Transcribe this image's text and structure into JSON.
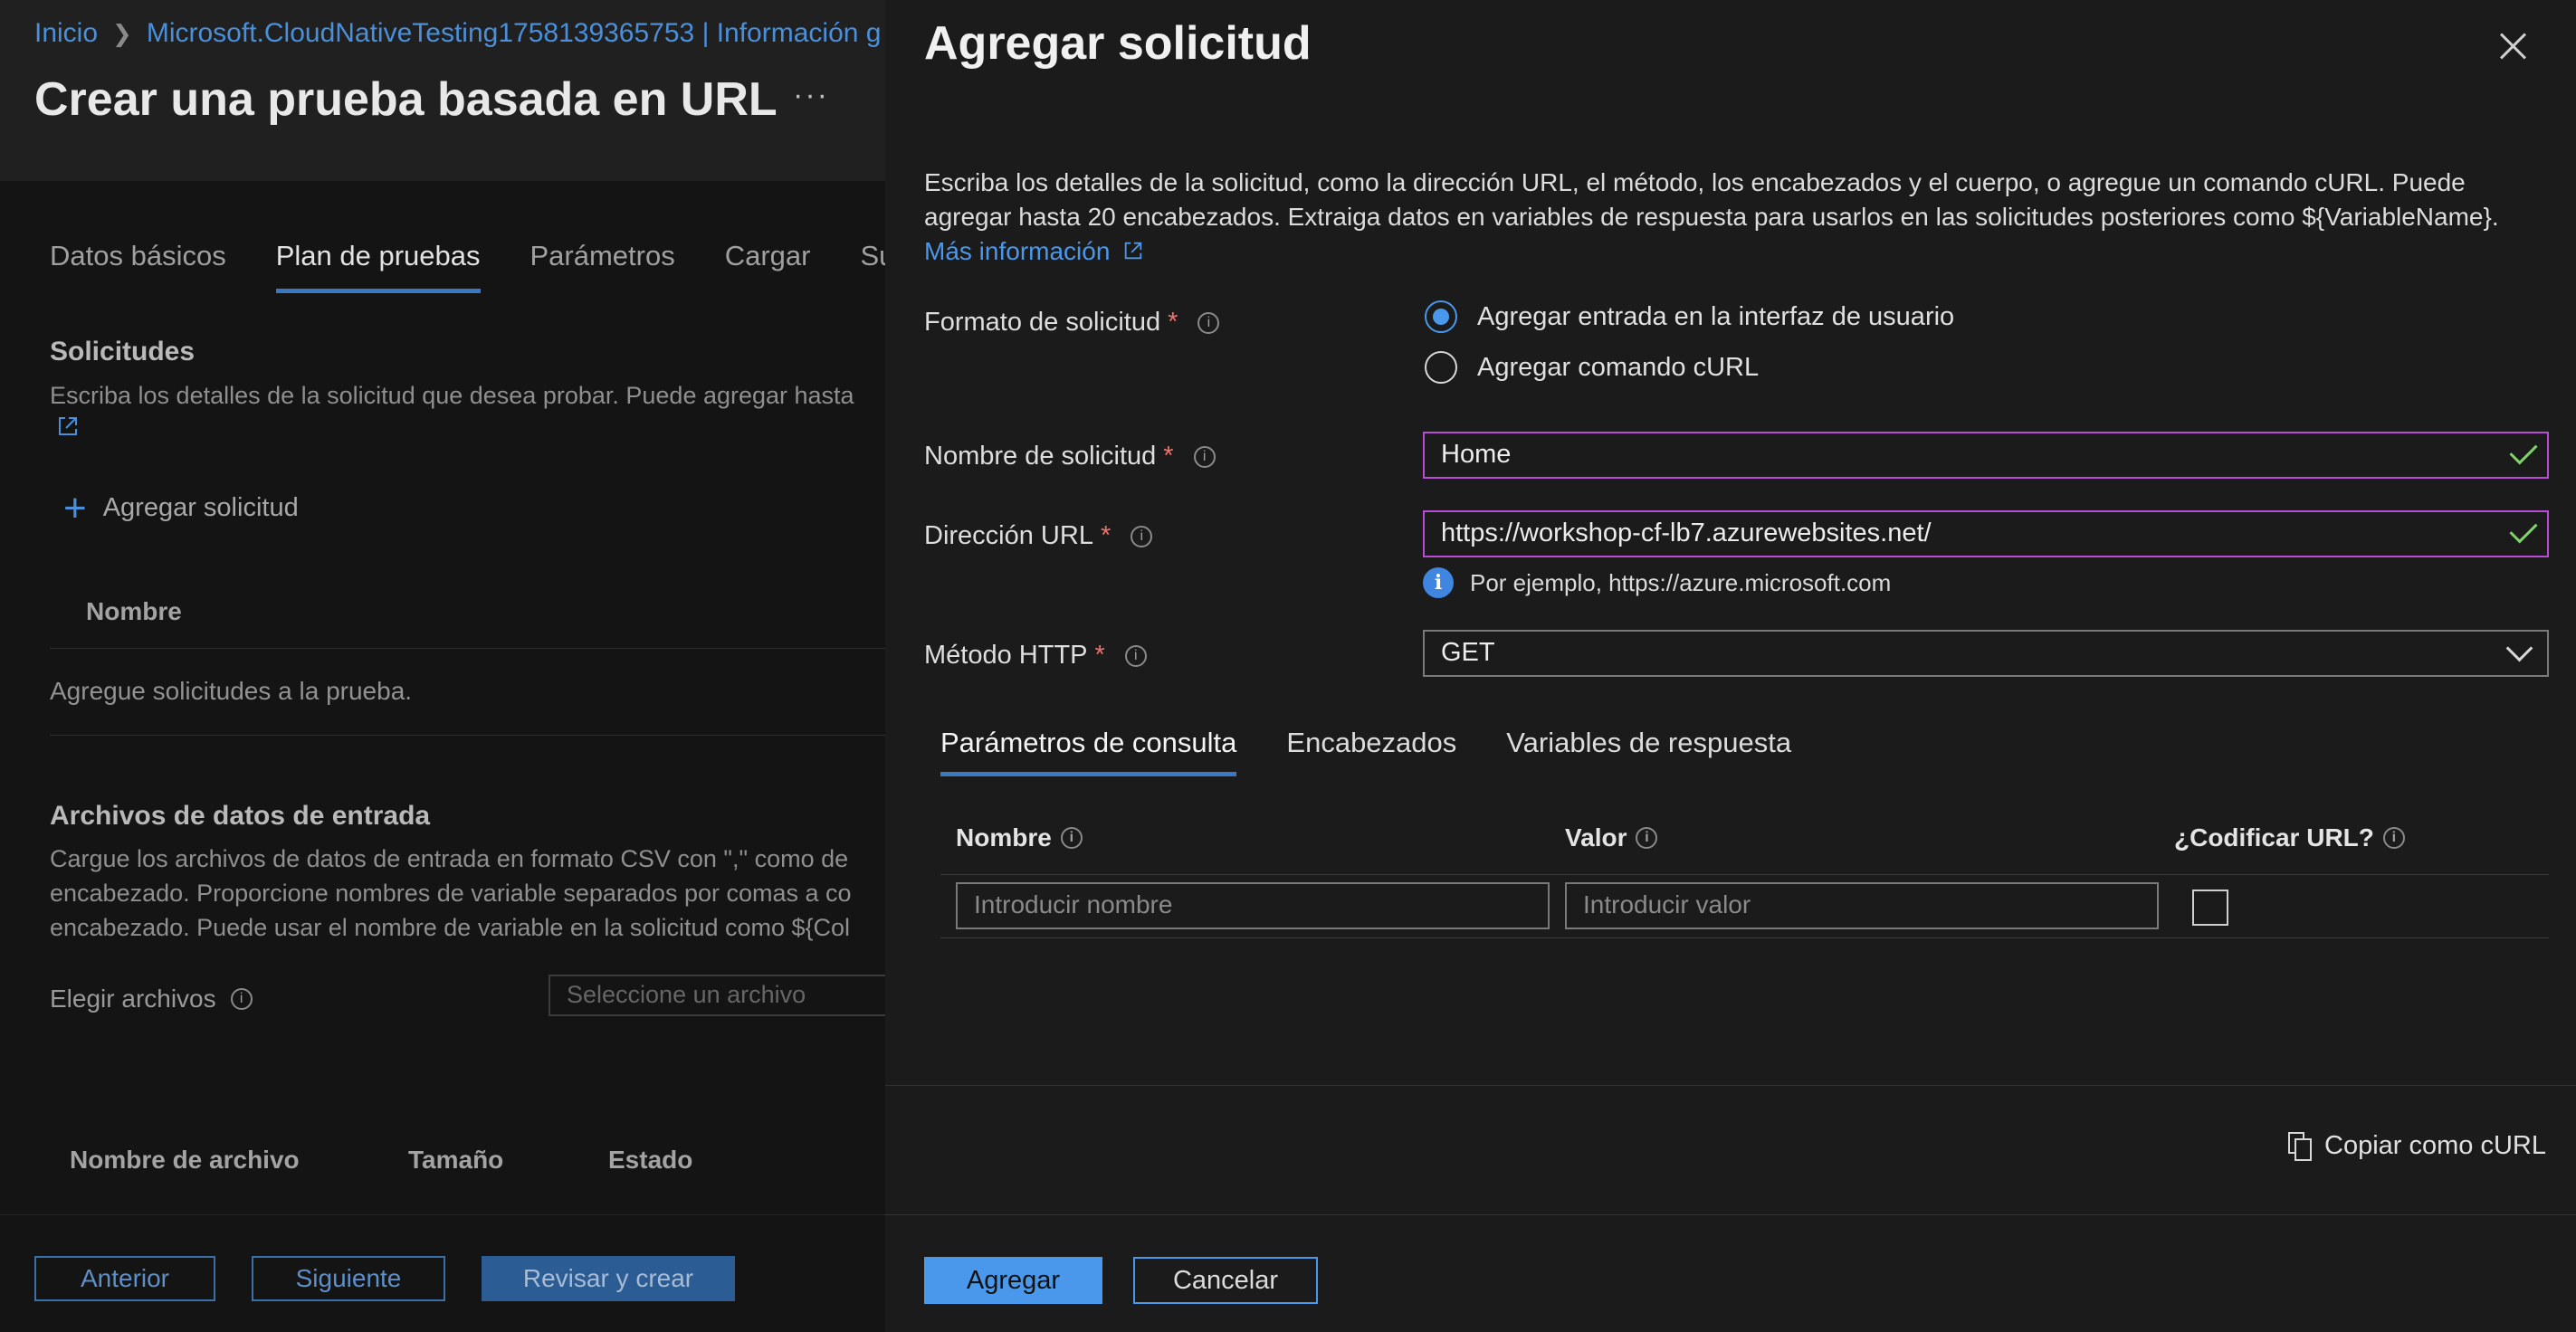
{
  "background": {
    "breadcrumb": [
      "Inicio",
      "Microsoft.CloudNativeTesting1758139365753 | Información g"
    ],
    "page_title": "Crear una prueba basada en URL",
    "more_label": "···",
    "tabs": [
      {
        "label": "Datos básicos",
        "active": false
      },
      {
        "label": "Plan de pruebas",
        "active": true
      },
      {
        "label": "Parámetros",
        "active": false
      },
      {
        "label": "Cargar",
        "active": false
      },
      {
        "label": "Sup",
        "active": false
      }
    ],
    "requests": {
      "title": "Solicitudes",
      "description": "Escriba los detalles de la solicitud que desea probar. Puede agregar hasta",
      "add_label": "Agregar solicitud",
      "column_name": "Nombre",
      "empty_message": "Agregue solicitudes a la prueba."
    },
    "input_files": {
      "title": "Archivos de datos de entrada",
      "description_lines": [
        "Cargue los archivos de datos de entrada en formato CSV con \",\" como de",
        "encabezado. Proporcione nombres de variable separados por comas a co",
        "encabezado. Puede usar el nombre de variable en la solicitud como ${Col"
      ],
      "choose_label": "Elegir archivos",
      "file_placeholder": "Seleccione un archivo",
      "columns": [
        "Nombre de archivo",
        "Tamaño",
        "Estado"
      ]
    },
    "footer": {
      "previous": "Anterior",
      "next": "Siguiente",
      "review": "Revisar y crear"
    }
  },
  "panel": {
    "title": "Agregar solicitud",
    "description": "Escriba los detalles de la solicitud, como la dirección URL, el método, los encabezados y el cuerpo, o agregue un comando cURL. Puede agregar hasta 20 encabezados. Extraiga datos en variables de respuesta para usarlos en las solicitudes posteriores como ${VariableName}.",
    "learn_more": "Más información",
    "format": {
      "label": "Formato de solicitud",
      "options": [
        {
          "label": "Agregar entrada en la interfaz de usuario",
          "selected": true
        },
        {
          "label": "Agregar comando cURL",
          "selected": false
        }
      ]
    },
    "request_name": {
      "label": "Nombre de solicitud",
      "value": "Home"
    },
    "url": {
      "label": "Dirección URL",
      "value": "https://workshop-cf-lb7.azurewebsites.net/",
      "hint": "Por ejemplo, https://azure.microsoft.com"
    },
    "method": {
      "label": "Método HTTP",
      "value": "GET"
    },
    "tabs": [
      {
        "label": "Parámetros de consulta",
        "active": true
      },
      {
        "label": "Encabezados",
        "active": false
      },
      {
        "label": "Variables de respuesta",
        "active": false
      }
    ],
    "table": {
      "col_name": "Nombre",
      "col_value": "Valor",
      "col_encode": "¿Codificar URL?",
      "name_placeholder": "Introducir nombre",
      "value_placeholder": "Introducir valor"
    },
    "copy_curl": "Copiar como cURL",
    "add_button": "Agregar",
    "cancel_button": "Cancelar"
  },
  "colors": {
    "accent": "#4a98eb",
    "focus_border": "#b84cd6",
    "valid_check": "#7fd36a",
    "required": "#f0706a"
  }
}
